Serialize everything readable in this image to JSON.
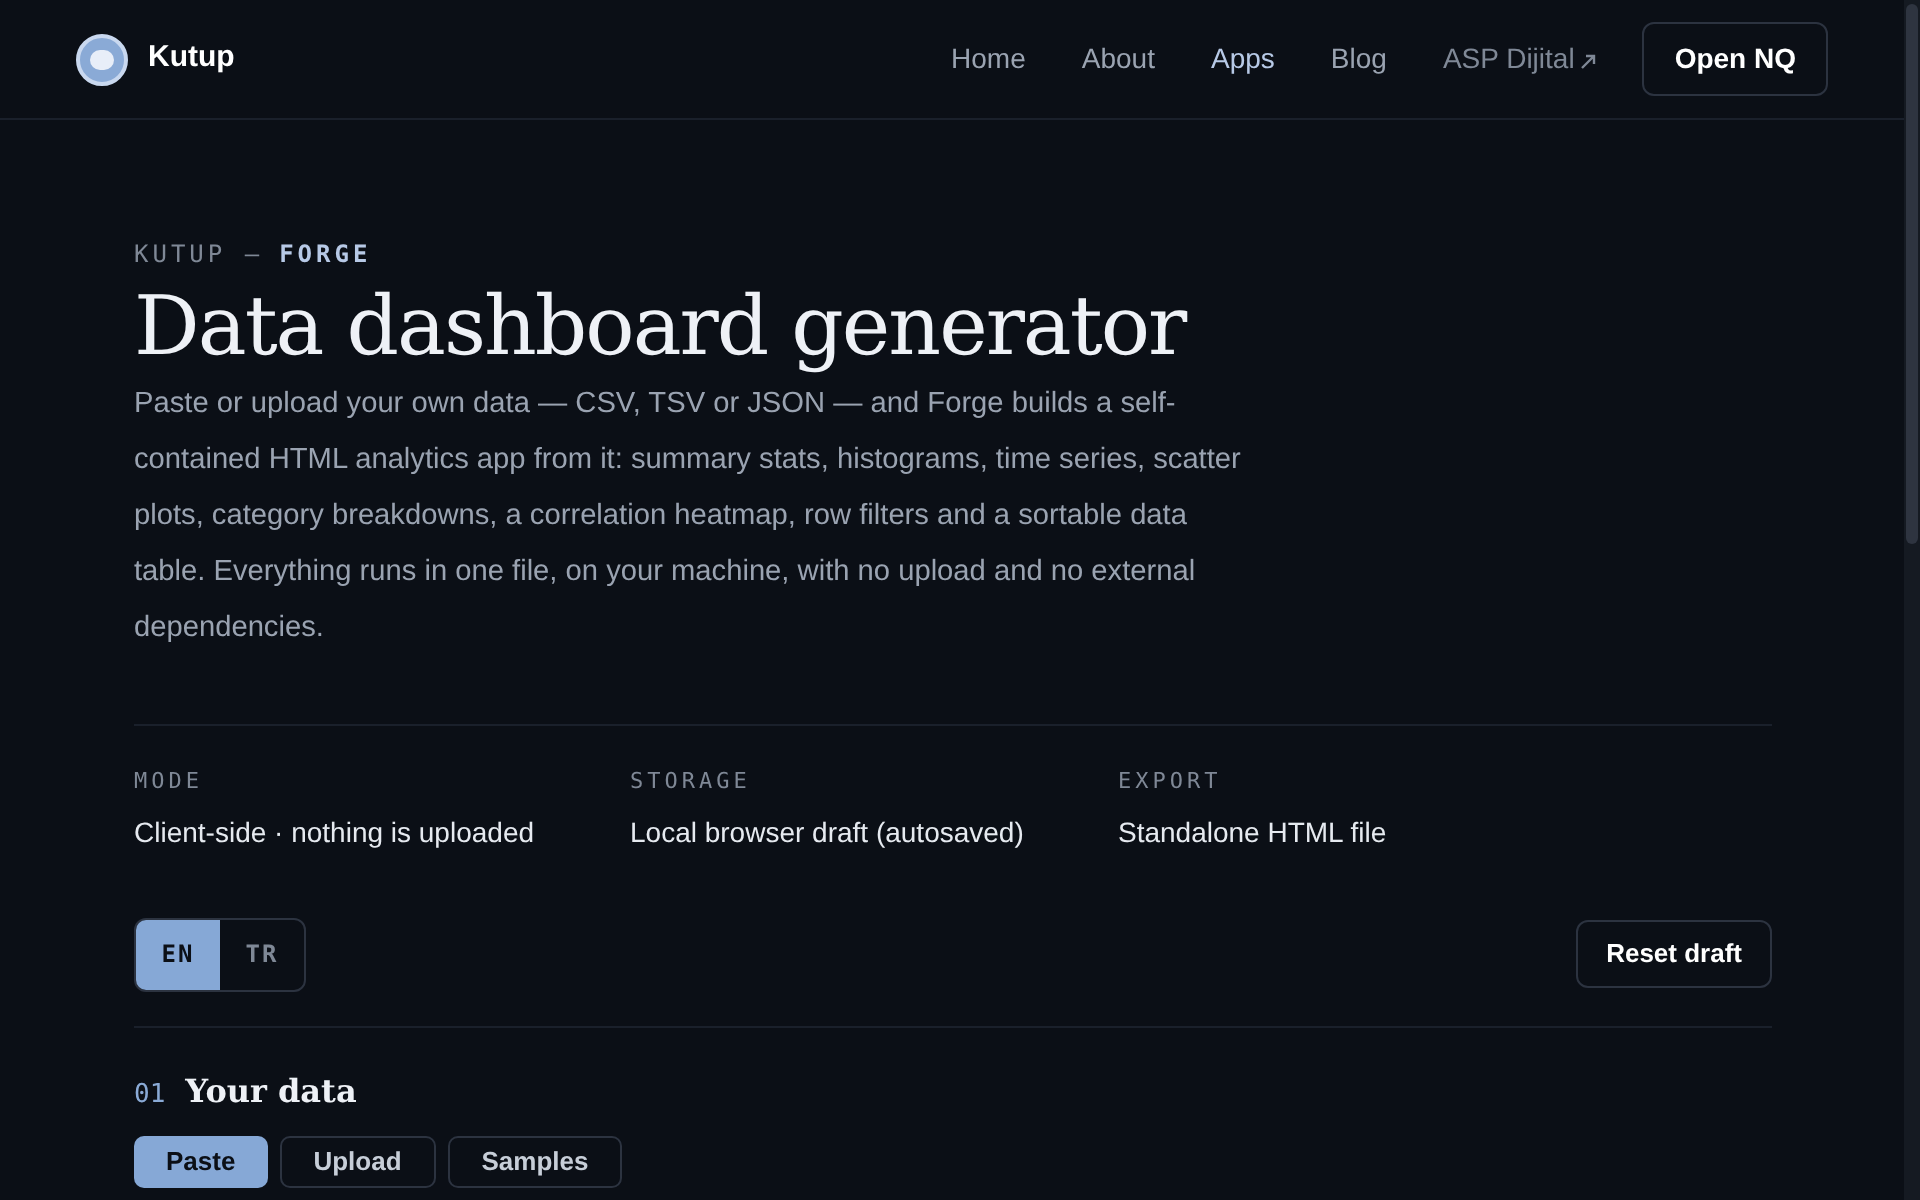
{
  "brand": {
    "name": "Kutup"
  },
  "nav": [
    {
      "label": "Home",
      "selected": false
    },
    {
      "label": "About",
      "selected": false
    },
    {
      "label": "Apps",
      "selected": true
    },
    {
      "label": "Blog",
      "selected": false
    },
    {
      "label": "ASP Dijital",
      "selected": false,
      "external": true
    }
  ],
  "nav_button": "Open NQ",
  "eyebrow": {
    "prefix": "KUTUP —",
    "name": "FORGE"
  },
  "title": "Data dashboard generator",
  "description": "Paste or upload your own data — CSV, TSV or JSON — and Forge builds a self-contained HTML analytics app from it: summary stats, histograms, time series, scatter plots, category breakdowns, a correlation heatmap, row filters and a sortable data table. Everything runs in one file, on your machine, with no upload and no external dependencies.",
  "facts": [
    {
      "label": "MODE",
      "value": "Client-side · nothing is uploaded"
    },
    {
      "label": "STORAGE",
      "value": "Local browser draft (autosaved)"
    },
    {
      "label": "EXPORT",
      "value": "Standalone HTML file"
    }
  ],
  "languages": [
    {
      "label": "EN",
      "selected": true
    },
    {
      "label": "TR",
      "selected": false
    }
  ],
  "reset_button": "Reset draft",
  "section": {
    "number": "01",
    "title": "Your data"
  },
  "data_tabs": [
    {
      "label": "Paste",
      "selected": true
    },
    {
      "label": "Upload",
      "selected": false
    },
    {
      "label": "Samples",
      "selected": false
    }
  ]
}
